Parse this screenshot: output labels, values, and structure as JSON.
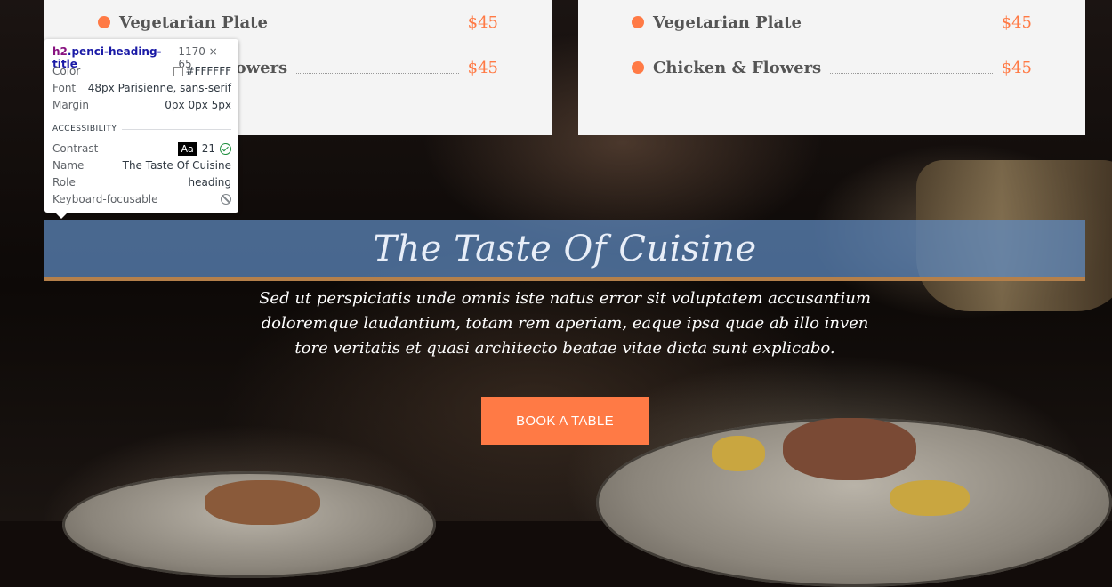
{
  "menu": {
    "left": [
      {
        "name": "Vegetarian Plate",
        "price": "$45"
      },
      {
        "name": "Chicken & Flowers",
        "price": "$45"
      }
    ],
    "right": [
      {
        "name": "Vegetarian Plate",
        "price": "$45"
      },
      {
        "name": "Chicken & Flowers",
        "price": "$45"
      }
    ]
  },
  "heading": {
    "title": "The Taste Of Cuisine"
  },
  "description": {
    "line1": "Sed ut perspiciatis unde omnis iste natus error sit voluptatem accusantium",
    "line2": "doloremque laudantium, totam rem aperiam, eaque ipsa quae ab illo inven",
    "line3": "tore veritatis et quasi architecto beatae vitae dicta sunt explicabo."
  },
  "cta": {
    "label": "BOOK A TABLE"
  },
  "colors": {
    "accent": "#FF7A45",
    "band": "#608CC3",
    "band_border": "#B5804A",
    "card_bg": "#F4F4F4"
  },
  "inspector": {
    "selector_tag": "h2",
    "selector_class": ".penci-heading-title",
    "size": "1170 × 65",
    "rows": {
      "color_label": "Color",
      "color_value": "#FFFFFF",
      "font_label": "Font",
      "font_value": "48px Parisienne, sans-serif",
      "margin_label": "Margin",
      "margin_value": "0px 0px 5px"
    },
    "section": "ACCESSIBILITY",
    "a11y": {
      "contrast_label": "Contrast",
      "contrast_badge": "Aa",
      "contrast_value": "21",
      "name_label": "Name",
      "name_value": "The Taste Of Cuisine",
      "role_label": "Role",
      "role_value": "heading",
      "focus_label": "Keyboard-focusable"
    },
    "icons": {
      "contrast_ok": "check-circle-icon",
      "focusable": "not-allowed-icon"
    }
  }
}
